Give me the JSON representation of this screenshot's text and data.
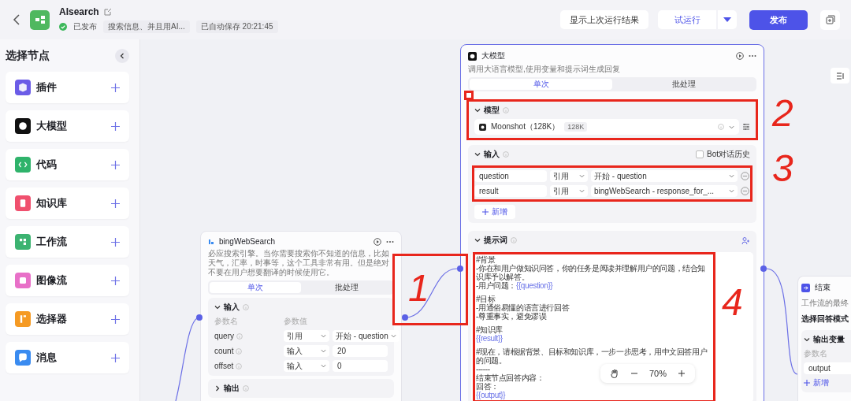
{
  "header": {
    "title": "AIsearch",
    "status": "已发布",
    "description": "搜索信息、并且用AI...",
    "autosave": "已自动保存 20:21:45"
  },
  "toolbar": {
    "show_last": "显示上次运行结果",
    "test_run": "试运行",
    "publish": "发布"
  },
  "sidebar": {
    "title": "选择节点",
    "items": [
      {
        "label": "插件",
        "color": "#6b5ce7"
      },
      {
        "label": "大模型",
        "color": "#111111"
      },
      {
        "label": "代码",
        "color": "#2fb36b"
      },
      {
        "label": "知识库",
        "color": "#f0506e"
      },
      {
        "label": "工作流",
        "color": "#3cb371"
      },
      {
        "label": "图像流",
        "color": "#e870c8"
      },
      {
        "label": "选择器",
        "color": "#f59a23"
      },
      {
        "label": "消息",
        "color": "#3a8bf0"
      }
    ]
  },
  "search_node": {
    "title": "bingWebSearch",
    "description": "必应搜索引擎。当你需要搜索你不知道的信息，比如天气，汇率，时事等，这个工具非常有用。但是绝对不要在用户想要翻译的时候使用它。",
    "tabs": [
      {
        "label": "单次",
        "selected": true
      },
      {
        "label": "批处理",
        "selected": false
      }
    ],
    "input_title": "输入",
    "col_name": "参数名",
    "col_value": "参数值",
    "params": [
      {
        "name": "query",
        "mode": "引用",
        "value": "开始 - question",
        "kind": "select"
      },
      {
        "name": "count",
        "mode": "输入",
        "value": "20",
        "kind": "text"
      },
      {
        "name": "offset",
        "mode": "输入",
        "value": "0",
        "kind": "text"
      }
    ],
    "output_title": "输出",
    "output_expanded": false
  },
  "llm_node": {
    "title": "大模型",
    "description": "调用大语言模型,使用变量和提示词生成回复",
    "tabs": [
      {
        "label": "单次",
        "selected": true
      },
      {
        "label": "批处理",
        "selected": false
      }
    ],
    "model_title": "模型",
    "model": "Moonshot（128K）",
    "model_badge": "128K",
    "input_title": "输入",
    "history_label": "Bot对话历史",
    "history_checked": false,
    "inputs": [
      {
        "name": "question",
        "mode": "引用",
        "value": "开始 - question"
      },
      {
        "name": "result",
        "mode": "引用",
        "value": "bingWebSearch - response_for_..."
      }
    ],
    "add_label": "新增",
    "prompt_title": "提示词",
    "prompt_lines": [
      {
        "text": "#背景",
        "gap": false
      },
      {
        "text": "-你在和用户做知识问答，你的任务是阅读并理解用户的问题，结合知识库予以解答。",
        "gap": false
      },
      {
        "text": "-用户问题：",
        "var": "{{question}}",
        "gap": false
      },
      {
        "text": "#目标",
        "gap": true
      },
      {
        "text": "-用通俗易懂的语言进行回答",
        "gap": false
      },
      {
        "text": "-尊重事实，避免谬误",
        "gap": false
      },
      {
        "text": "#知识库",
        "gap": true
      },
      {
        "var": "{{result}}",
        "gap": false
      },
      {
        "text": "#现在，请根据背景、目标和知识库，一步一步思考，用中文回答用户的问题。",
        "gap": true
      },
      {
        "text": "------",
        "gap": false
      },
      {
        "text": "结束节点回答内容：",
        "gap": false
      },
      {
        "text": "回答：",
        "gap": false
      },
      {
        "var": "{{output}}",
        "gap": false
      }
    ]
  },
  "end_node": {
    "title": "结束",
    "description": "工作流的最终",
    "mode_label": "选择回答模式",
    "output_title": "输出变量",
    "col_name": "参数名",
    "row": "output",
    "add_label": "新增"
  },
  "zoom": {
    "level": "70%"
  },
  "annotations": [
    {
      "label": "1"
    },
    {
      "label": "2"
    },
    {
      "label": "3"
    },
    {
      "label": "4"
    }
  ]
}
